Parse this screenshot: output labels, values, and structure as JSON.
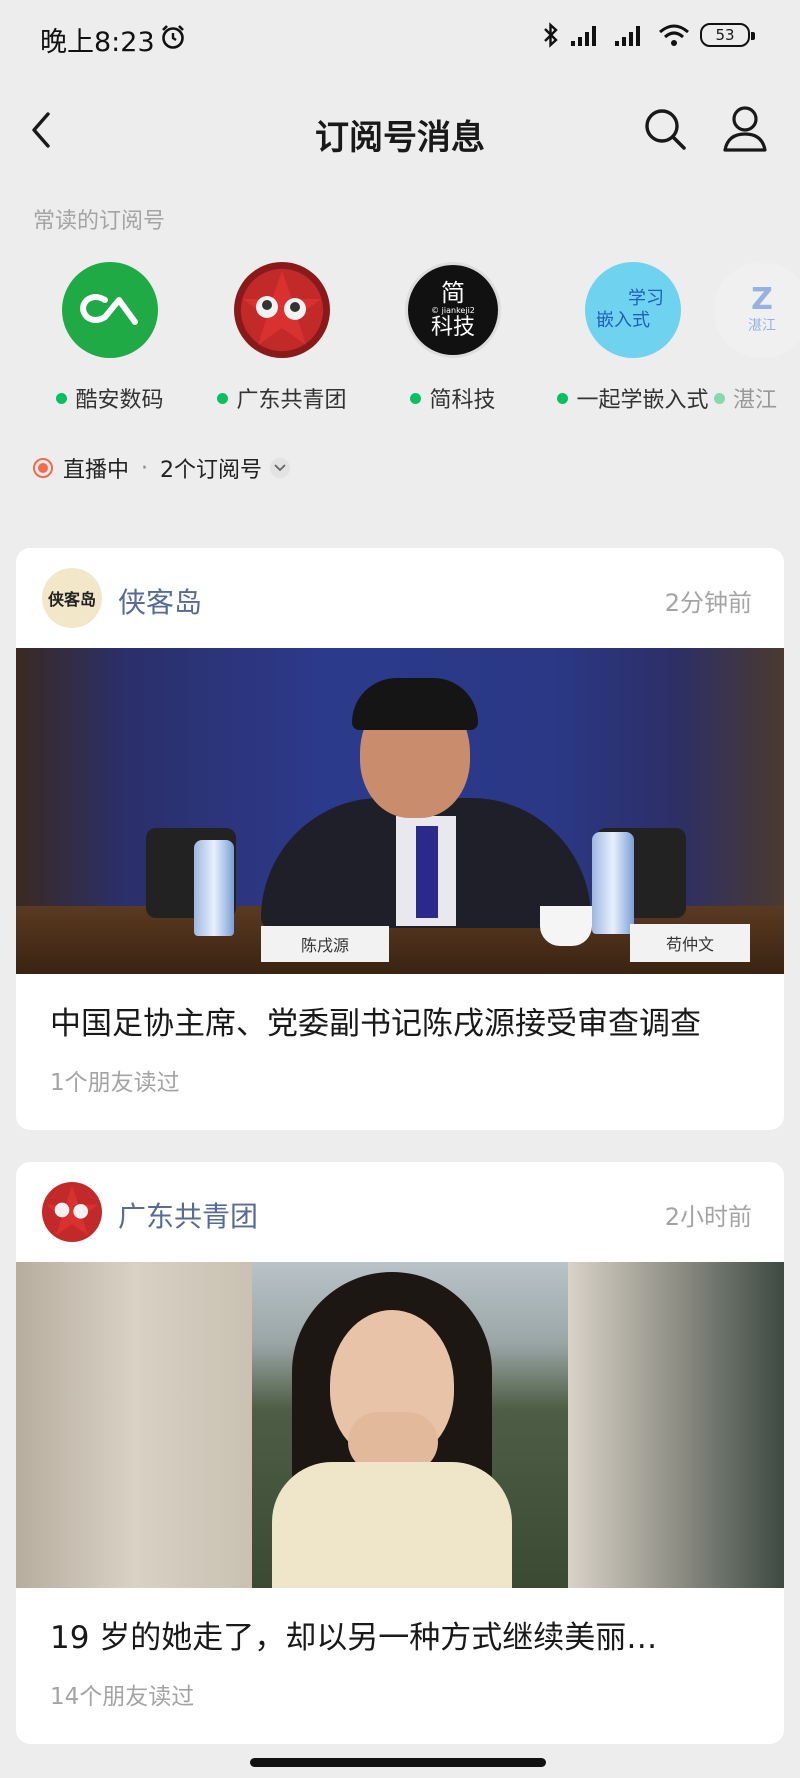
{
  "status_bar": {
    "time": "晚上8:23",
    "battery": "53"
  },
  "nav": {
    "title": "订阅号消息"
  },
  "frequent": {
    "label": "常读的订阅号",
    "items": [
      {
        "name": "酷安数码",
        "avatar_color": "#1faa45"
      },
      {
        "name": "广东共青团",
        "avatar_color": "#c22a2a"
      },
      {
        "name": "简科技",
        "avatar_text_top": "简",
        "avatar_text_sub": "© jiankeji2",
        "avatar_text_bottom": "科技"
      },
      {
        "name": "一起学嵌入式",
        "avatar_text_a": "学习",
        "avatar_text_b": "嵌入式",
        "avatar_color": "#6fd3f0"
      },
      {
        "name": "湛江",
        "avatar_text": "Z",
        "avatar_sub": "湛江"
      }
    ]
  },
  "live": {
    "label": "直播中",
    "count": "2个订阅号"
  },
  "cards": [
    {
      "account": "侠客岛",
      "avatar_text": "侠客岛",
      "time": "2分钟前",
      "nameplate_left": "陈戌源",
      "nameplate_right": "苟仲文",
      "title": "中国足协主席、党委副书记陈戌源接受审查调查",
      "sub": "1个朋友读过"
    },
    {
      "account": "广东共青团",
      "time": "2小时前",
      "title": "19 岁的她走了，却以另一种方式继续美丽…",
      "sub": "14个朋友读过"
    }
  ],
  "colors": {
    "accent_green": "#07c160",
    "link_blue": "#576b95",
    "live_red": "#f26a4a"
  }
}
